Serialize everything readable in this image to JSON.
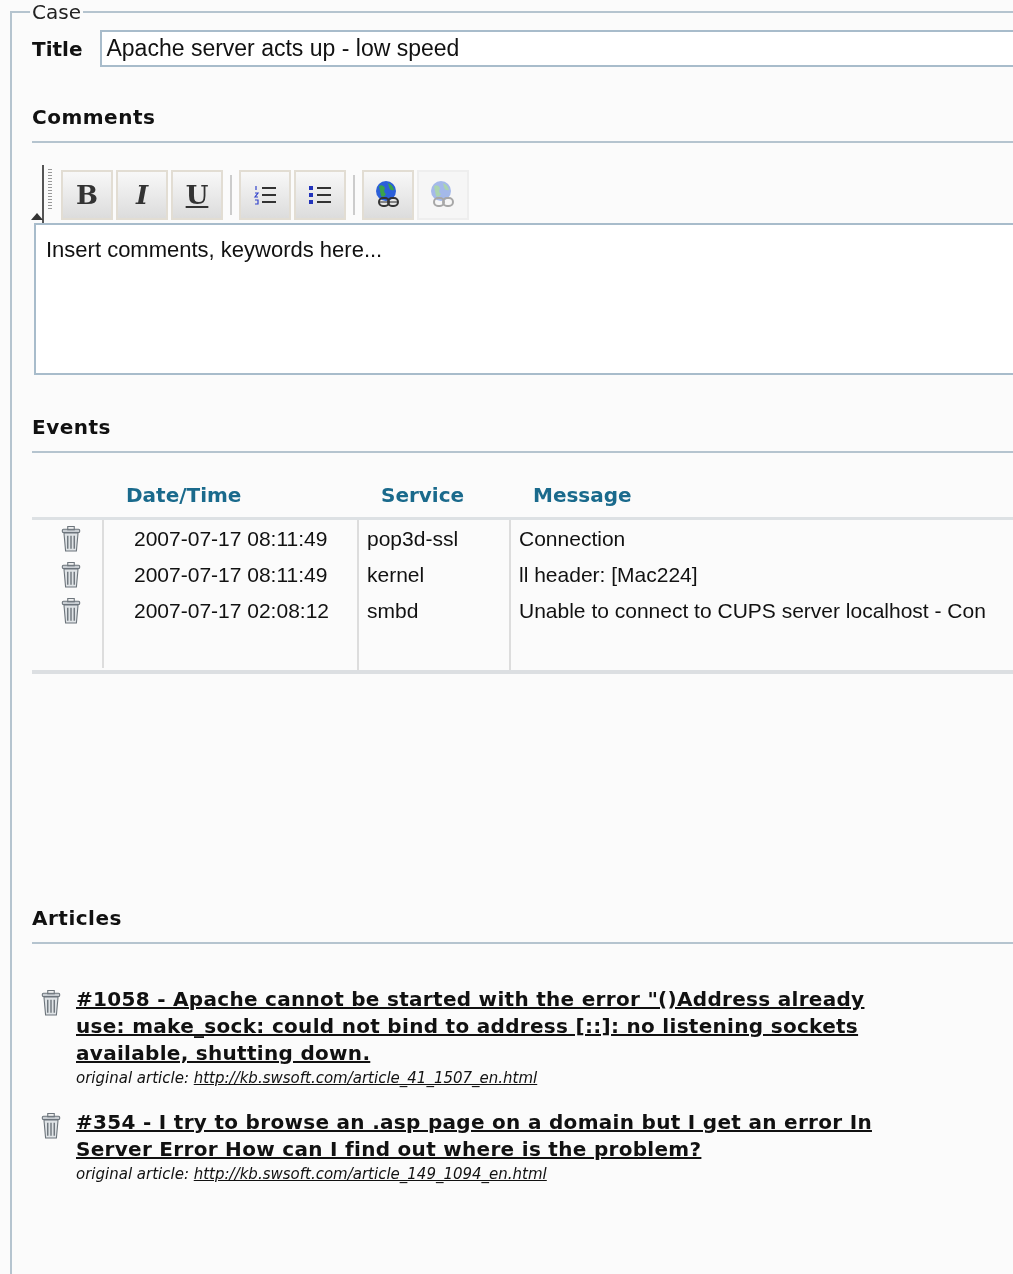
{
  "case": {
    "legend": "Case",
    "title_label": "Title",
    "title_value": "Apache server acts up - low speed"
  },
  "comments": {
    "heading": "Comments",
    "toolbar": [
      {
        "kind": "bold",
        "label": "B",
        "disabled": false
      },
      {
        "kind": "italic",
        "label": "I",
        "disabled": false
      },
      {
        "kind": "underline",
        "label": "U",
        "disabled": false
      },
      {
        "kind": "ordered-list",
        "disabled": false
      },
      {
        "kind": "bullet-list",
        "disabled": false
      },
      {
        "kind": "link",
        "disabled": false
      },
      {
        "kind": "unlink",
        "disabled": true
      }
    ],
    "value": "Insert comments, keywords here..."
  },
  "events": {
    "heading": "Events",
    "columns": [
      "Date/Time",
      "Service",
      "Message"
    ],
    "rows": [
      {
        "date_time": "2007-07-17 08:11:49",
        "service": "pop3d-ssl",
        "message": "Connection"
      },
      {
        "date_time": "2007-07-17 08:11:49",
        "service": "kernel",
        "message": "ll header: [Mac224]"
      },
      {
        "date_time": "2007-07-17 02:08:12",
        "service": "smbd",
        "message": "Unable to connect to CUPS server localhost - Con"
      }
    ]
  },
  "articles": {
    "heading": "Articles",
    "items": [
      {
        "title_lines": [
          "#1058 - Apache cannot be started with the error \"()Address already",
          "use: make_sock: could not bind to address [::]: no listening sockets",
          "available, shutting down."
        ],
        "source_label": "original article:",
        "url": "http://kb.swsoft.com/article_41_1507_en.html"
      },
      {
        "title_lines": [
          "#354 - I try to browse an .asp page on a domain but I get an error In",
          "Server Error How can I find out where is the problem?"
        ],
        "source_label": "original article:",
        "url": "http://kb.swsoft.com/article_149_1094_en.html"
      }
    ]
  }
}
